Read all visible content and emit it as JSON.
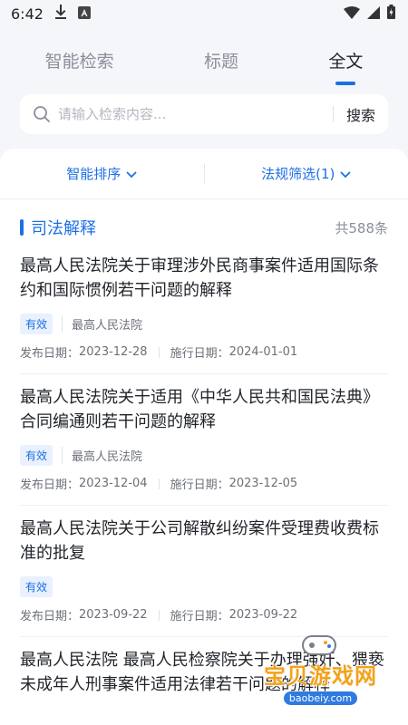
{
  "status": {
    "time": "6:42"
  },
  "tabs": [
    {
      "label": "智能检索",
      "active": false
    },
    {
      "label": "标题",
      "active": false
    },
    {
      "label": "全文",
      "active": true
    }
  ],
  "search": {
    "placeholder": "请输入检索内容...",
    "button": "搜索"
  },
  "filters": {
    "sort": "智能排序",
    "regulation": "法规筛选(1)"
  },
  "section": {
    "title": "司法解释",
    "count": "共588条"
  },
  "labels": {
    "publish": "发布日期：",
    "effective": "施行日期："
  },
  "items": [
    {
      "title": "最高人民法院关于审理涉外民商事案件适用国际条约和国际惯例若干问题的解释",
      "status": "有效",
      "issuer": "最高人民法院",
      "publish_date": "2023-12-28",
      "effective_date": "2024-01-01"
    },
    {
      "title": "最高人民法院关于适用《中华人民共和国民法典》合同编通则若干问题的解释",
      "status": "有效",
      "issuer": "最高人民法院",
      "publish_date": "2023-12-04",
      "effective_date": "2023-12-05"
    },
    {
      "title": "最高人民法院关于公司解散纠纷案件受理费收费标准的批复",
      "status": "有效",
      "issuer": "",
      "publish_date": "2023-09-22",
      "effective_date": "2023-09-22"
    },
    {
      "title": "最高人民法院 最高人民检察院关于办理强奸、猥亵未成年人刑事案件适用法律若干问题的解释",
      "status": "",
      "issuer": "",
      "publish_date": "",
      "effective_date": ""
    }
  ],
  "watermark": {
    "text": "宝贝游戏网",
    "url": "baobeiy.com"
  },
  "colors": {
    "accent": "#1e6fe5",
    "badge_bg": "#e8f1fd",
    "watermark": "#f3a21b"
  }
}
